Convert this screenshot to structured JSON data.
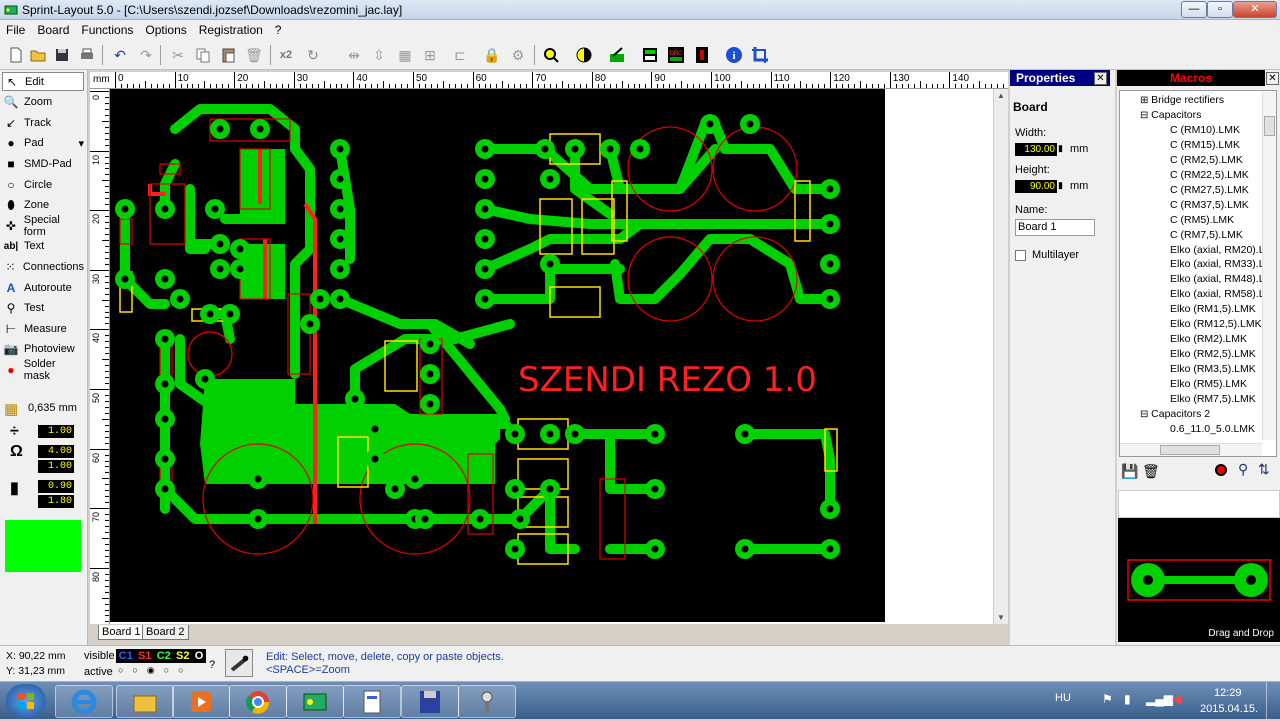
{
  "window": {
    "title": "Sprint-Layout 5.0 - [C:\\Users\\szendi.jozsef\\Downloads\\rezomini_jac.lay]",
    "min": "—",
    "max": "▫",
    "close": "✕"
  },
  "menu": [
    "File",
    "Board",
    "Functions",
    "Options",
    "Registration",
    "?"
  ],
  "toolbar": {
    "x2": "x2"
  },
  "tools": [
    {
      "label": "Edit",
      "icon": "arrow-icon"
    },
    {
      "label": "Zoom",
      "icon": "zoom-icon"
    },
    {
      "label": "Track",
      "icon": "track-icon"
    },
    {
      "label": "Pad",
      "icon": "pad-icon"
    },
    {
      "label": "SMD-Pad",
      "icon": "smd-pad-icon"
    },
    {
      "label": "Circle",
      "icon": "circle-icon"
    },
    {
      "label": "Zone",
      "icon": "zone-icon"
    },
    {
      "label": "Special form",
      "icon": "special-form-icon"
    },
    {
      "label": "Text",
      "icon": "text-icon"
    },
    {
      "label": "Connections",
      "icon": "connections-icon"
    },
    {
      "label": "Autoroute",
      "icon": "autoroute-icon"
    },
    {
      "label": "Test",
      "icon": "test-icon"
    },
    {
      "label": "Measure",
      "icon": "measure-icon"
    },
    {
      "label": "Photoview",
      "icon": "photoview-icon"
    },
    {
      "label": "Solder mask",
      "icon": "solder-mask-icon"
    }
  ],
  "grid": {
    "value": "0,635 mm"
  },
  "track_params": {
    "width": "1.00",
    "pad_outer": "4.00",
    "pad_inner": "1.00",
    "smd_w": "0.90",
    "smd_h": "1.80"
  },
  "layer_color": "#00ff00",
  "ruler": {
    "unit": "mm",
    "top": [
      "0",
      "10",
      "20",
      "30",
      "40",
      "50",
      "60",
      "70",
      "80",
      "90",
      "100",
      "110",
      "120",
      "130",
      "140"
    ],
    "left": [
      "0",
      "10",
      "20",
      "30",
      "40",
      "50",
      "60",
      "70",
      "80"
    ]
  },
  "board_text": "SZENDI REZO 1.0",
  "tabs": [
    "Board 1",
    "Board 2"
  ],
  "properties": {
    "header": "Properties",
    "section": "Board",
    "width_label": "Width:",
    "width": "130.00",
    "height_label": "Height:",
    "height": "90.00",
    "unit": "mm",
    "name_label": "Name:",
    "name": "Board 1",
    "multilayer": "Multilayer"
  },
  "macros": {
    "header": "Macros",
    "items": [
      {
        "label": "Bridge rectifiers",
        "folder": true,
        "expanded": false
      },
      {
        "label": "Capacitors",
        "folder": true,
        "expanded": true
      },
      {
        "label": "C (RM10).LMK"
      },
      {
        "label": "C (RM15).LMK"
      },
      {
        "label": "C (RM2,5).LMK"
      },
      {
        "label": "C (RM22,5).LMK"
      },
      {
        "label": "C (RM27,5).LMK"
      },
      {
        "label": "C (RM37,5).LMK"
      },
      {
        "label": "C (RM5).LMK"
      },
      {
        "label": "C (RM7,5).LMK"
      },
      {
        "label": "Elko (axial, RM20).LM"
      },
      {
        "label": "Elko (axial, RM33).LM"
      },
      {
        "label": "Elko (axial, RM48).LM"
      },
      {
        "label": "Elko (axial, RM58).LM"
      },
      {
        "label": "Elko (RM1,5).LMK"
      },
      {
        "label": "Elko (RM12,5).LMK"
      },
      {
        "label": "Elko (RM2).LMK"
      },
      {
        "label": "Elko (RM2,5).LMK"
      },
      {
        "label": "Elko (RM3,5).LMK"
      },
      {
        "label": "Elko (RM5).LMK"
      },
      {
        "label": "Elko (RM7,5).LMK"
      },
      {
        "label": "Capacitors 2",
        "folder": true,
        "expanded": true
      },
      {
        "label": "0.6_11.0_5.0.LMK"
      }
    ],
    "drag": "Drag and Drop"
  },
  "status": {
    "x": "X:  90,22 mm",
    "y": "Y:  31,23 mm",
    "visible": "visible",
    "active": "active",
    "layers": [
      "C1",
      "S1",
      "C2",
      "S2",
      "O"
    ],
    "q": "?",
    "hint1": "Edit: Select, move, delete, copy or paste objects.",
    "hint2": "<SPACE>=Zoom"
  },
  "tray": {
    "lang": "HU",
    "time": "12:29",
    "date": "2015.04.15."
  }
}
